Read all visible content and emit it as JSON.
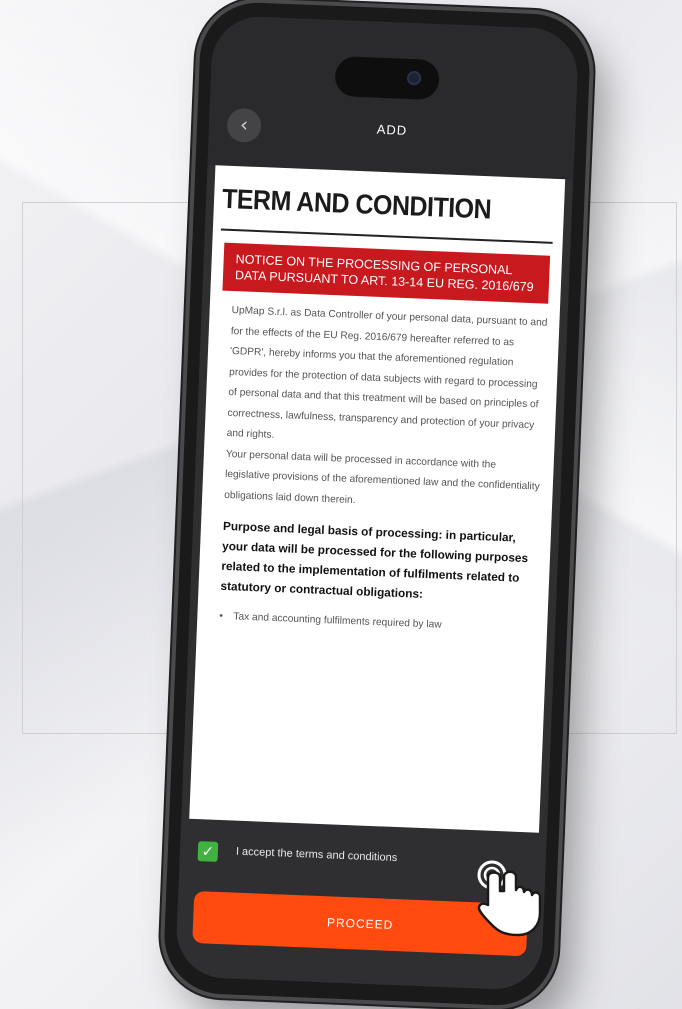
{
  "app": {
    "title": "ADD",
    "back_icon": "chevron-left-icon"
  },
  "terms": {
    "heading": "TERM AND CONDITION",
    "notice": "NOTICE ON THE PROCESSING OF PERSONAL DATA PURSUANT TO ART. 13-14 EU REG. 2016/679",
    "paragraph1": "UpMap S.r.l. as Data Controller of your personal data, pursuant to and for the effects of the EU Reg. 2016/679 hereafter referred to as 'GDPR', hereby informs you that the aforementioned regulation provides for the protection of data subjects with regard to processing of personal data and that this treatment will be based on principles of correctness, lawfulness, transparency and protection of your privacy and rights.",
    "paragraph2": "Your personal data will be processed in accordance with the legislative provisions of the aforementioned law and the confidentiality obligations laid down therein.",
    "purpose": "Purpose and legal basis of processing: in particular, your data will be processed for the following purposes related to the implementation of fulfilments related to statutory or contractual obligations:",
    "bullet1": "Tax and accounting fulfilments required by law"
  },
  "footer": {
    "accept_label": "I accept the terms and conditions",
    "accept_checked": true,
    "proceed_label": "PROCEED"
  },
  "colors": {
    "accent": "#ff4a10",
    "notice_red": "#c8191f",
    "checkbox_green": "#3fb23f"
  }
}
